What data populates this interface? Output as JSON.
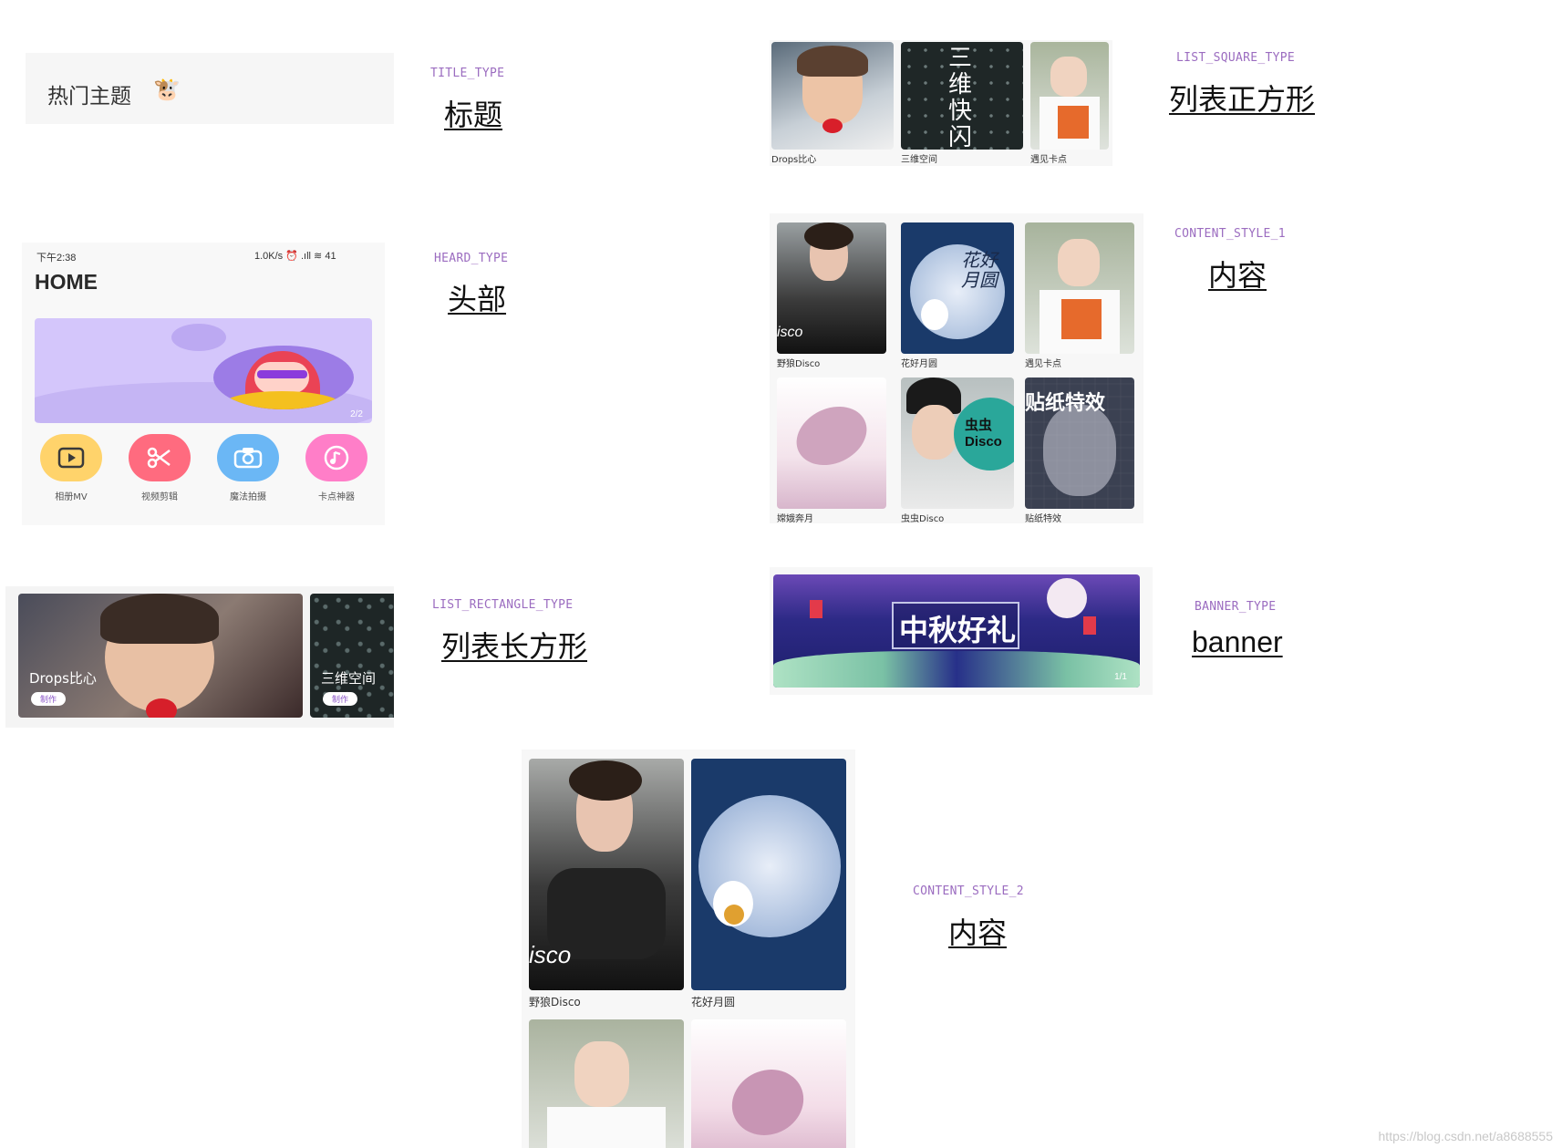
{
  "title_type": {
    "label": "TITLE_TYPE",
    "cn": "标题",
    "header_text": "热门主题",
    "emoji": "🐮"
  },
  "heard_type": {
    "label": "HEARD_TYPE",
    "cn": "头部",
    "status_time": "下午2:38",
    "status_right": "1.0K/s ⏰ .ıll ≋ 41",
    "home": "HOME",
    "pager": "2/2",
    "buttons": [
      {
        "label": "相册MV",
        "color": "#ffd36b",
        "icon": "play-icon"
      },
      {
        "label": "视频剪辑",
        "color": "#ff6b7f",
        "icon": "scissors-icon"
      },
      {
        "label": "魔法拍摄",
        "color": "#6bb7f5",
        "icon": "camera-icon"
      },
      {
        "label": "卡点神器",
        "color": "#ff7ec8",
        "icon": "music-icon"
      }
    ]
  },
  "list_square": {
    "label": "LIST_SQUARE_TYPE",
    "cn": "列表正方形",
    "items": [
      "Drops比心",
      "三维空间",
      "遇见卡点"
    ],
    "overlay": "三维快闪"
  },
  "content1": {
    "label": "CONTENT_STYLE_1",
    "cn": "内容",
    "items": [
      "野狼Disco",
      "花好月圆",
      "遇见卡点",
      "嫦娥奔月",
      "虫虫Disco",
      "贴纸特效"
    ],
    "overlays": [
      "isco",
      "花好月圆",
      "虫虫 Disco",
      "贴纸特效"
    ]
  },
  "list_rect": {
    "label": "LIST_RECTANGLE_TYPE",
    "cn": "列表长方形",
    "items": [
      "Drops比心",
      "三维空间"
    ],
    "make": "制作"
  },
  "banner": {
    "label": "BANNER_TYPE",
    "cn": "banner",
    "text": "中秋好礼",
    "pager": "1/1"
  },
  "content2": {
    "label": "CONTENT_STYLE_2",
    "cn": "内容",
    "items": [
      "野狼Disco",
      "花好月圆"
    ],
    "overlay": "isco"
  },
  "watermark": "https://blog.csdn.net/a8688555"
}
